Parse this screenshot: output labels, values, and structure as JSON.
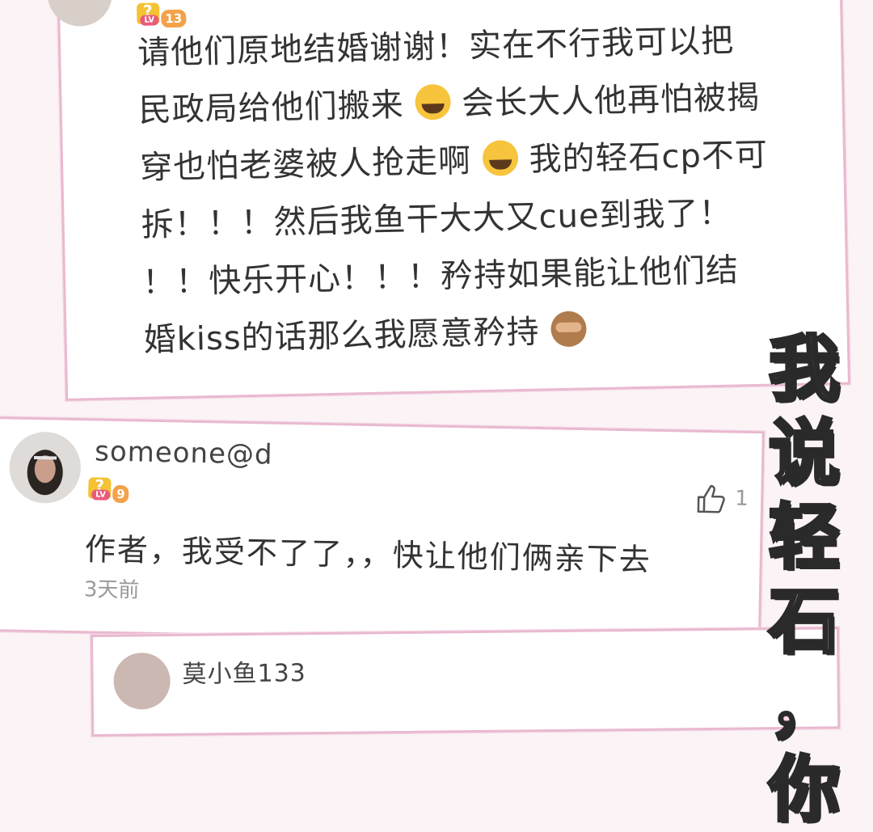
{
  "comment1": {
    "level": "13",
    "level_prefix": "LV",
    "text_lines": [
      "请他们原地结婚谢谢！实在不行我可以把",
      "民政局给他们搬来",
      "会长大人他再怕被揭",
      "穿也怕老婆被人抢走啊",
      "我的轻石cp不可",
      "拆！！！然后我鱼干大大又cue到我了！",
      "！！快乐开心！！！矜持如果能让他们结",
      "婚kiss的话那么我愿意矜持"
    ],
    "emojis": [
      "face-with-tears-of-joy",
      "face-with-tears-of-joy",
      "see-no-evil-monkey"
    ]
  },
  "comment2": {
    "username": "someone@d",
    "level": "9",
    "level_prefix": "LV",
    "text": "作者，我受不了了，，快让他们俩亲下去",
    "time": "3天前",
    "like_count": "1"
  },
  "comment3": {
    "username_partial": "莫小鱼133"
  },
  "side_caption": {
    "chars": [
      "我",
      "说",
      "轻",
      "石",
      "，",
      "你"
    ]
  },
  "colors": {
    "border_pink": "#e9b9d0",
    "caption_fill": "#fbd8e8",
    "level_gold": "#f5c234"
  }
}
